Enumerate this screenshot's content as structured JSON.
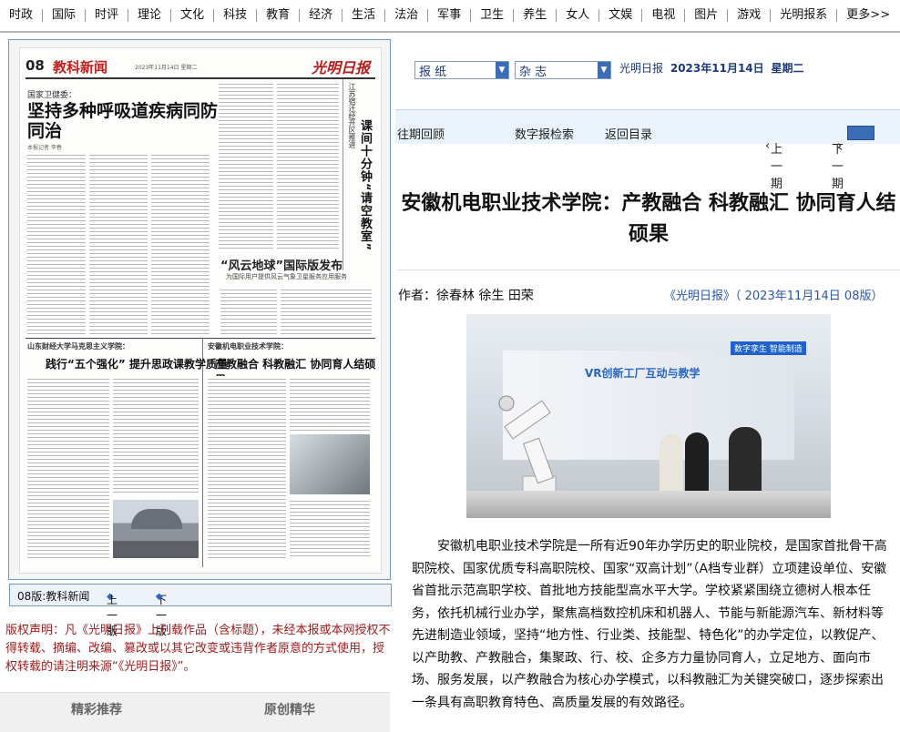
{
  "nav": [
    "时政",
    "国际",
    "时评",
    "理论",
    "文化",
    "科技",
    "教育",
    "经济",
    "生活",
    "法治",
    "军事",
    "卫生",
    "养生",
    "女人",
    "文娱",
    "电视",
    "图片",
    "游戏",
    "光明报系",
    "更多>>"
  ],
  "paper": {
    "page_num": "08",
    "section": "教科新闻",
    "date_line": "2023年11月14日 星期二",
    "logo": "光明日报",
    "kicker": "国家卫健委：",
    "h1": "坚持多种呼吸道疾病同防同治",
    "byline": "本报记者 李春",
    "side_small": "江苏宿迁经开区推进",
    "side_big": "课间十分钟“请空教室”",
    "sub_title": "“风云地球”国际版发布",
    "sub_title2": "为国际用户提供风云气象卫星服务应用服务",
    "article2_kicker": "山东财经大学马克思主义学院：",
    "article2_title": "践行“五个强化” 提升思政课教学质量",
    "article3_kicker": "安徽机电职业技术学院：",
    "article3_title": "产教融合 科教融汇 协同育人结硕果"
  },
  "paper_nav": {
    "current": "08版:教科新闻",
    "prev": "上一版",
    "next": "下一版"
  },
  "copyright": "版权声明：凡《光明日报》上刊载作品（含标题），未经本报或本网授权不得转载、摘编、改编、篡改或以其它改变或违背作者原意的方式使用，授权转载的请注明来源“《光明日报》”。",
  "tabs": [
    "精彩推荐",
    "原创精华"
  ],
  "selectors": {
    "paper": "报  纸",
    "magazine": "杂  志"
  },
  "edition": {
    "name": "光明日报",
    "date": "2023年11月14日",
    "weekday": "星期二"
  },
  "toolbar": {
    "past": "往期回顾",
    "search": "数字报检索",
    "back": "返回目录",
    "prev": "上一期",
    "next": "下一期"
  },
  "article": {
    "title": "安徽机电职业技术学院：产教融合 科教融汇 协同育人结硕果",
    "author": "作者：徐春林  徐生  田荣",
    "source": "《光明日报》（ 2023年11月14日   08版）",
    "photo_sign": "VR创新工厂互动与教学",
    "photo_sign2": "数字孪生  智能制造",
    "body": "安徽机电职业技术学院是一所有近90年办学历史的职业院校，是国家首批骨干高职院校、国家优质专科高职院校、国家“双高计划”（A档专业群）立项建设单位、安徽省首批示范高职学校、首批地方技能型高水平大学。学校紧紧围绕立德树人根本任务，依托机械行业办学，聚焦高档数控机床和机器人、节能与新能源汽车、新材料等先进制造业领域，坚持“地方性、行业类、技能型、特色化”的办学定位，以教促产、以产助教、产教融合，集聚政、行、校、企多方力量协同育人，立足地方、面向市场、服务发展，以产教融合为核心办学模式，以科教融汇为关键突破口，逐步探索出一条具有高职教育特色、高质量发展的有效路径。"
  },
  "colors": {
    "nav_border": "#b5b5b5",
    "link_blue": "#2a55a8",
    "copyright_red": "#9b1b1b",
    "select_blue": "#3b6cb6"
  }
}
